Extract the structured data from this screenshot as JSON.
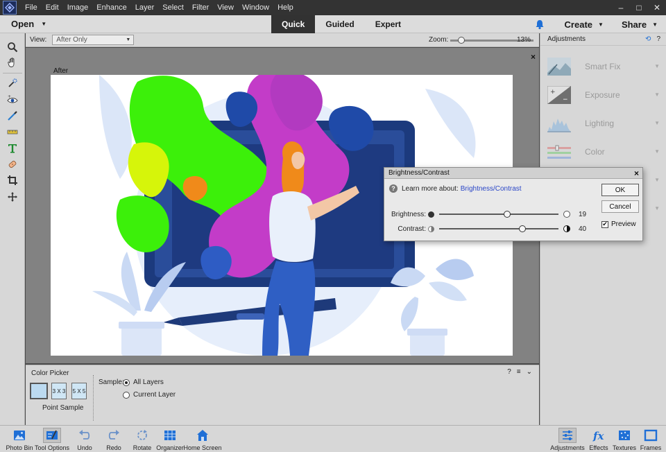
{
  "menubar": {
    "items": [
      "File",
      "Edit",
      "Image",
      "Enhance",
      "Layer",
      "Select",
      "Filter",
      "View",
      "Window",
      "Help"
    ],
    "window_controls": [
      "–",
      "□",
      "✕"
    ]
  },
  "modebar": {
    "open_label": "Open",
    "tabs": [
      "Quick",
      "Guided",
      "Expert"
    ],
    "active_tab": "Quick",
    "create_label": "Create",
    "share_label": "Share"
  },
  "viewbar": {
    "view_label": "View:",
    "view_value": "After Only",
    "zoom_label": "Zoom:",
    "zoom_value": "13%",
    "zoom_fraction": 0.13
  },
  "canvas": {
    "after_label": "After",
    "close": "×"
  },
  "adjustments": {
    "title": "Adjustments",
    "items": [
      "Smart Fix",
      "Exposure",
      "Lighting",
      "Color",
      "",
      ""
    ]
  },
  "dialog": {
    "title": "Brightness/Contrast",
    "learn_text": "Learn more about:",
    "learn_link": "Brightness/Contrast",
    "brightness_label": "Brightness:",
    "brightness_value": "19",
    "brightness_fraction": 0.57,
    "contrast_label": "Contrast:",
    "contrast_value": "40",
    "contrast_fraction": 0.7,
    "ok_label": "OK",
    "cancel_label": "Cancel",
    "preview_label": "Preview",
    "preview_checked": true
  },
  "tool_options": {
    "title": "Color Picker",
    "sample_sizes": [
      "",
      "3 X 3",
      "5 X 5"
    ],
    "point_sample_label": "Point Sample",
    "sample_label": "Sample:",
    "radio_all": "All Layers",
    "radio_current": "Current Layer",
    "selected_radio": "All Layers"
  },
  "bottombar": {
    "items": [
      "Photo Bin",
      "Tool Options",
      "Undo",
      "Redo",
      "Rotate",
      "Organizer",
      "Home Screen",
      "Adjustments",
      "Effects",
      "Textures",
      "Frames"
    ]
  },
  "colors": {
    "accent_blue": "#2a46c7",
    "active_tab_bg": "#323232",
    "splash_green": "#3cf00a",
    "splash_magenta": "#c33cc8",
    "monitor_navy": "#1e3a7a"
  }
}
